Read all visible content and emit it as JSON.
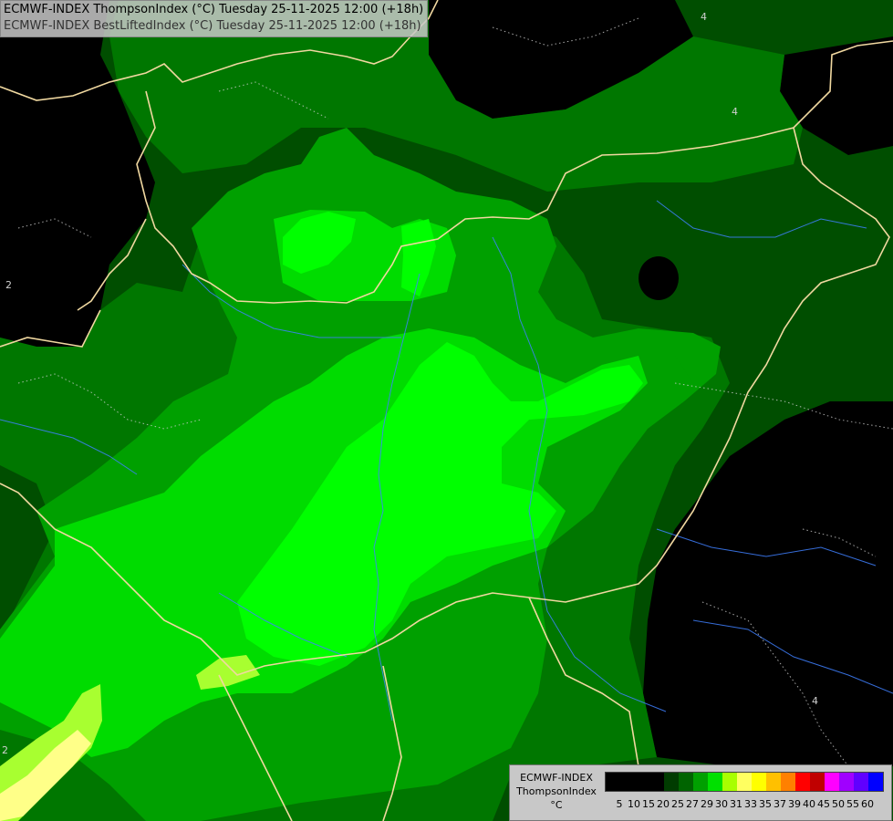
{
  "title": {
    "line1": "ECMWF-INDEX ThompsonIndex (°C) Tuesday 25-11-2025 12:00 (+18h)",
    "line2": "ECMWF-INDEX BestLiftedIndex (°C) Tuesday 25-11-2025 12:00 (+18h)"
  },
  "legend": {
    "model": "ECMWF-INDEX",
    "parameter": "ThompsonIndex",
    "unit": "°C",
    "ticks": [
      "5",
      "10",
      "15",
      "20",
      "25",
      "27",
      "29",
      "30",
      "31",
      "33",
      "35",
      "37",
      "39",
      "40",
      "45",
      "50",
      "55",
      "60"
    ],
    "colors": [
      "#000000",
      "#000000",
      "#000000",
      "#000000",
      "#003c00",
      "#006400",
      "#00a000",
      "#00e000",
      "#a8ff00",
      "#ffff60",
      "#ffff00",
      "#ffc000",
      "#ff8000",
      "#ff0000",
      "#c00000",
      "#ff00ff",
      "#a000ff",
      "#6000ff",
      "#0000ff"
    ]
  },
  "contour_labels": [
    "4",
    "4",
    "4",
    "2",
    "2",
    "4"
  ],
  "palette": {
    "dark": "#000000",
    "dark_green": "#004e00",
    "mid_green": "#007700",
    "green": "#00a000",
    "bright_green": "#00dc00",
    "lime": "#00ff00",
    "yellow_green": "#a8ff30",
    "pale_yellow": "#ffff88",
    "border": "#f0d8a0",
    "river": "#4080ff"
  }
}
